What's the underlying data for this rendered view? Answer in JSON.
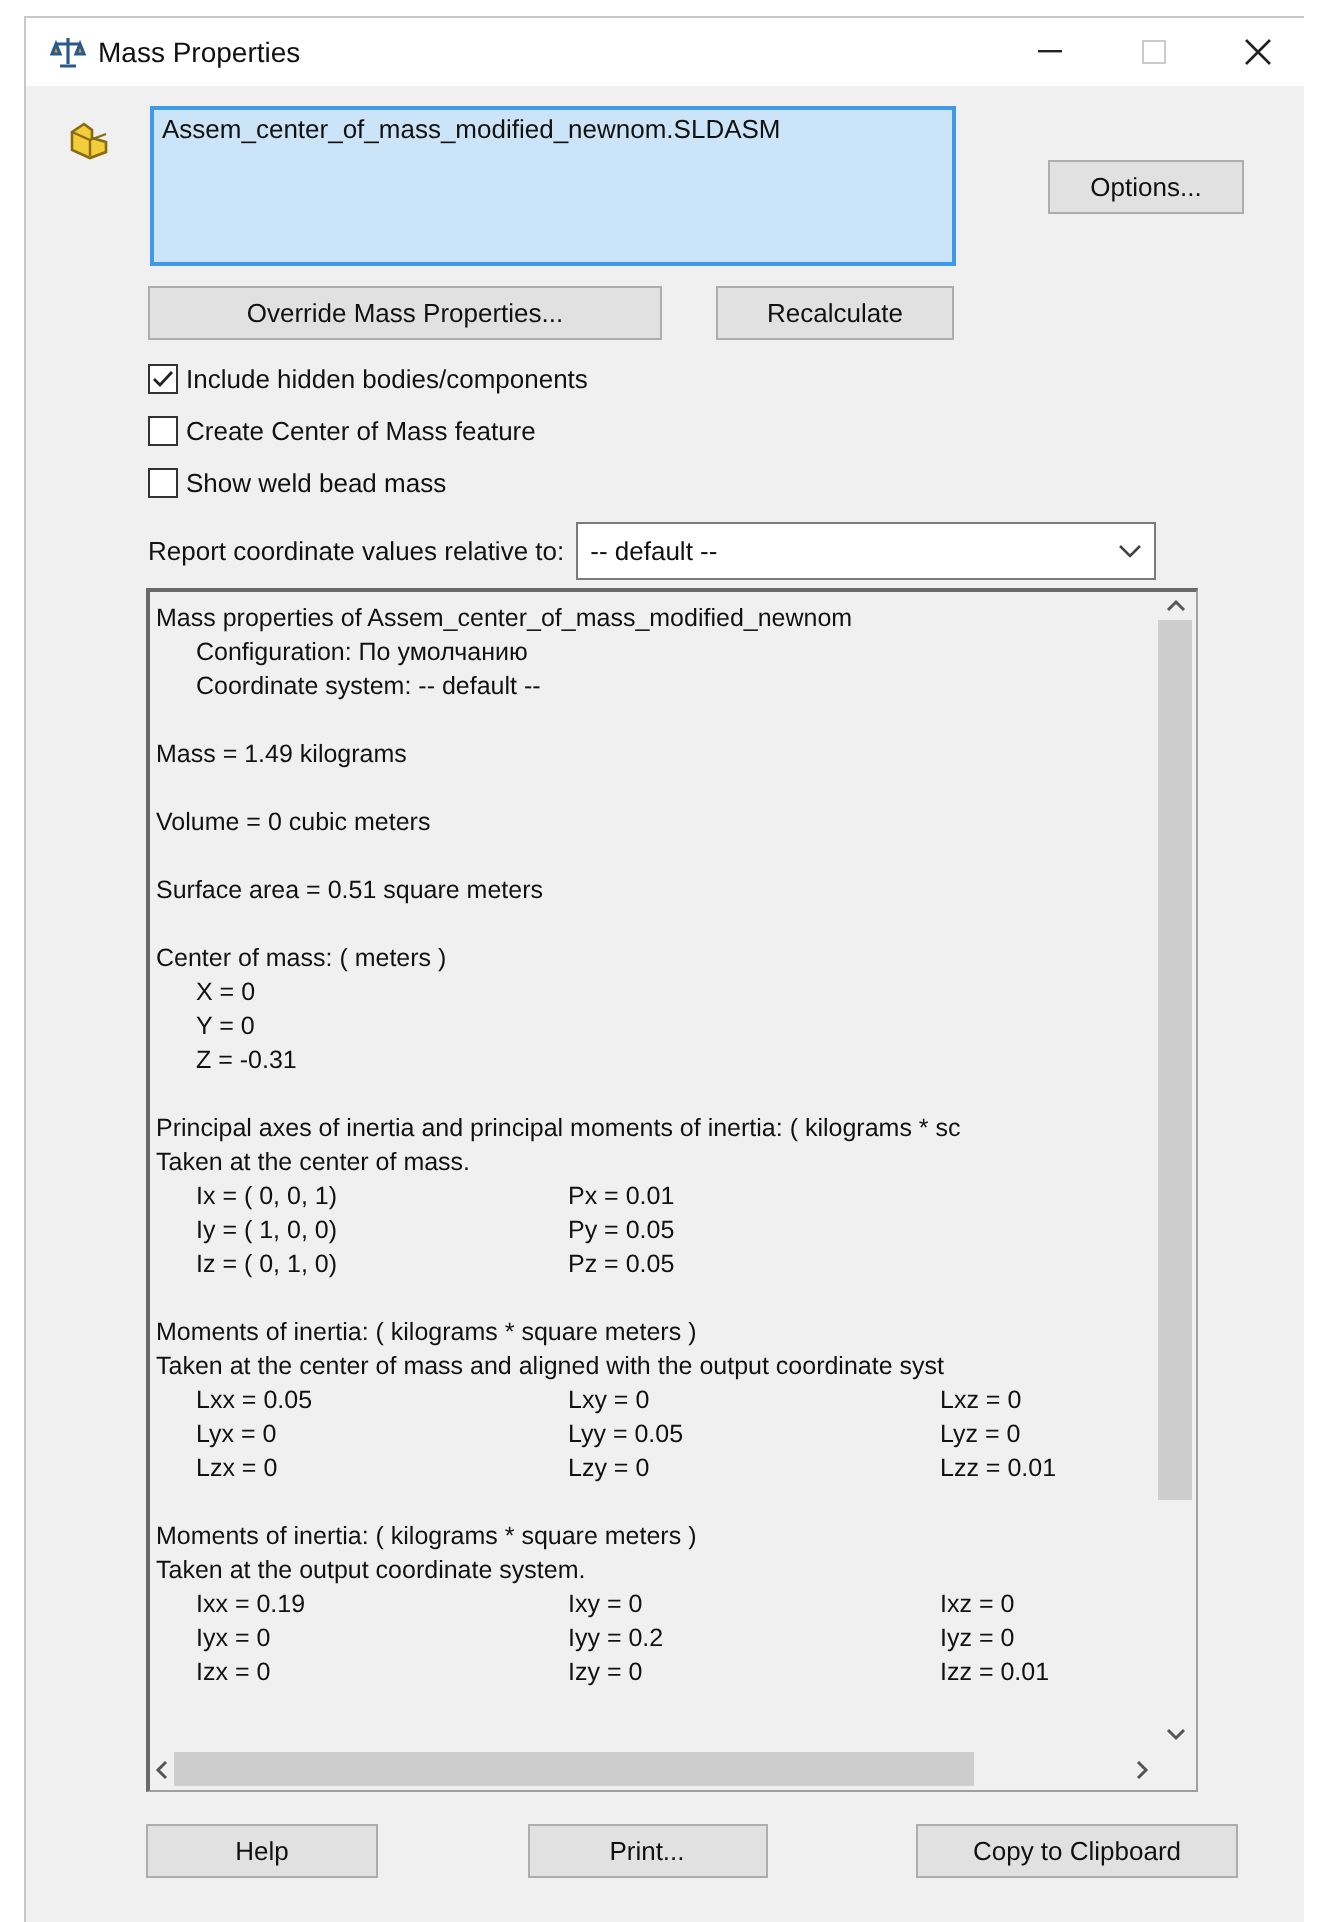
{
  "window": {
    "title": "Mass Properties"
  },
  "selection": {
    "items": [
      "Assem_center_of_mass_modified_newnom.SLDASM"
    ]
  },
  "buttons_top": {
    "options": "Options...",
    "override": "Override Mass Properties...",
    "recalculate": "Recalculate"
  },
  "checkboxes": [
    {
      "label": "Include hidden bodies/components",
      "checked": true
    },
    {
      "label": "Create Center of Mass feature",
      "checked": false
    },
    {
      "label": "Show weld bead mass",
      "checked": false
    }
  ],
  "coordinate": {
    "label": "Report coordinate values relative to:",
    "value": "-- default --"
  },
  "report": {
    "sections": [
      {
        "lines": [
          {
            "kind": "text",
            "indented": false,
            "text": "Mass properties of Assem_center_of_mass_modified_newnom"
          },
          {
            "kind": "text",
            "indented": true,
            "text": "Configuration: По умолчанию"
          },
          {
            "kind": "text",
            "indented": true,
            "text": "Coordinate system: -- default --"
          }
        ]
      },
      {
        "lines": [
          {
            "kind": "text",
            "indented": false,
            "text": "Mass = 1.49 kilograms"
          }
        ]
      },
      {
        "lines": [
          {
            "kind": "text",
            "indented": false,
            "text": "Volume = 0 cubic meters"
          }
        ]
      },
      {
        "lines": [
          {
            "kind": "text",
            "indented": false,
            "text": "Surface area = 0.51 square meters"
          }
        ]
      },
      {
        "lines": [
          {
            "kind": "text",
            "indented": false,
            "text": "Center of mass: ( meters )"
          },
          {
            "kind": "columns",
            "cells": [
              "X = 0"
            ]
          },
          {
            "kind": "columns",
            "cells": [
              "Y = 0"
            ]
          },
          {
            "kind": "columns",
            "cells": [
              "Z = -0.31"
            ]
          }
        ]
      },
      {
        "lines": [
          {
            "kind": "text",
            "indented": false,
            "text": "Principal axes of inertia and principal moments of inertia: ( kilograms * sc"
          },
          {
            "kind": "text",
            "indented": false,
            "text": "Taken at the center of mass."
          },
          {
            "kind": "columns",
            "cells": [
              "Ix = ( 0,  0,  1)",
              "Px = 0.01"
            ]
          },
          {
            "kind": "columns",
            "cells": [
              "Iy = ( 1,  0,  0)",
              "Py = 0.05"
            ]
          },
          {
            "kind": "columns",
            "cells": [
              "Iz = ( 0,  1,  0)",
              "Pz = 0.05"
            ]
          }
        ]
      },
      {
        "lines": [
          {
            "kind": "text",
            "indented": false,
            "text": "Moments of inertia: ( kilograms * square meters )"
          },
          {
            "kind": "text",
            "indented": false,
            "text": "Taken at the center of mass and aligned with the output coordinate syst"
          },
          {
            "kind": "columns",
            "cells": [
              "Lxx = 0.05",
              "Lxy = 0",
              "Lxz = 0"
            ]
          },
          {
            "kind": "columns",
            "cells": [
              "Lyx = 0",
              "Lyy = 0.05",
              "Lyz = 0"
            ]
          },
          {
            "kind": "columns",
            "cells": [
              "Lzx = 0",
              "Lzy = 0",
              "Lzz = 0.01"
            ]
          }
        ]
      },
      {
        "lines": [
          {
            "kind": "text",
            "indented": false,
            "text": "Moments of inertia: ( kilograms * square meters )"
          },
          {
            "kind": "text",
            "indented": false,
            "text": "Taken at the output coordinate system."
          },
          {
            "kind": "columns",
            "cells": [
              "Ixx = 0.19",
              "Ixy = 0",
              "Ixz = 0"
            ]
          },
          {
            "kind": "columns",
            "cells": [
              "Iyx = 0",
              "Iyy = 0.2",
              "Iyz = 0"
            ]
          },
          {
            "kind": "columns",
            "cells": [
              "Izx = 0",
              "Izy = 0",
              "Izz = 0.01"
            ]
          }
        ]
      }
    ]
  },
  "buttons_bottom": [
    "Help",
    "Print...",
    "Copy to Clipboard"
  ]
}
